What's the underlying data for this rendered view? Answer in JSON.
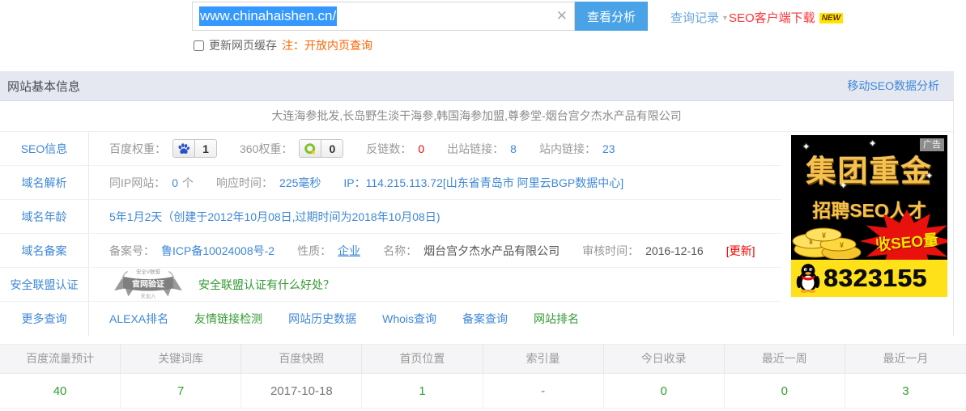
{
  "search": {
    "query": "www.chinahaishen.cn/",
    "clear_icon": "✕",
    "analyze_button": "查看分析",
    "history_link": "查询记录",
    "client_download": "SEO客户端下载",
    "new_badge": "NEW",
    "refresh_cache_label": "更新网页缓存",
    "note": "注：开放内页查询"
  },
  "section_header": {
    "title": "网站基本信息",
    "mobile_link": "移动SEO数据分析"
  },
  "site_title": "大连海参批发,长岛野生淡干海参,韩国海参加盟,尊参堂-烟台宫夕杰水产品有限公司",
  "seo_info": {
    "label": "SEO信息",
    "baidu_weight_label": "百度权重：",
    "baidu_weight": "1",
    "weight360_label": "360权重：",
    "weight360": "0",
    "backlinks_label": "反链数：",
    "backlinks": "0",
    "outbound_label": "出站链接：",
    "outbound": "8",
    "internal_label": "站内链接：",
    "internal": "23"
  },
  "dns": {
    "label": "域名解析",
    "same_ip_label": "同IP网站：",
    "same_ip": "0",
    "same_ip_unit": "个",
    "response_label": "响应时间：",
    "response": "225毫秒",
    "ip_full": "IP：114.215.113.72[山东省青岛市 阿里云BGP数据中心]"
  },
  "age": {
    "label": "域名年龄",
    "value": "5年1月2天（创建于2012年10月08日,过期时间为2018年10月08日)"
  },
  "icp": {
    "label": "域名备案",
    "number_label": "备案号：",
    "number": "鲁ICP备10024008号-2",
    "nature_label": "性质：",
    "nature": "企业",
    "name_label": "名称：",
    "name": "烟台宫夕杰水产品有限公司",
    "audit_label": "审核时间：",
    "audit": "2016-12-16",
    "update_link": "[更新]"
  },
  "security": {
    "label": "安全联盟认证",
    "badge_top": "安全V联盟",
    "badge_main": "官网验证",
    "badge_bottom": "未加入",
    "question_link": "安全联盟认证有什么好处？"
  },
  "more": {
    "label": "更多查询",
    "links": [
      {
        "text": "ALEXA排名"
      },
      {
        "text": "友情链接检测"
      },
      {
        "text": "网站历史数据"
      },
      {
        "text": "Whois查询"
      },
      {
        "text": "备案查询"
      },
      {
        "text": "网站排名"
      }
    ]
  },
  "ad": {
    "tag": "广告",
    "line1": "集团重金",
    "line2": "招聘SEO人才",
    "burst": "收SEO量",
    "qq_number": "8323155"
  },
  "stats": {
    "headers": [
      "百度流量预计",
      "关键词库",
      "百度快照",
      "首页位置",
      "索引量",
      "今日收录",
      "最近一周",
      "最近一月"
    ],
    "values": [
      "40",
      "7",
      "2017-10-18",
      "1",
      "-",
      "0",
      "0",
      "3"
    ]
  }
}
